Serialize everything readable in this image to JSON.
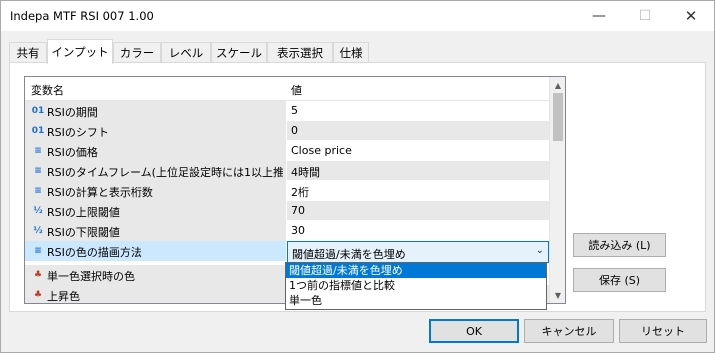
{
  "window": {
    "title": "Indepa MTF RSI 007 1.00"
  },
  "titlebar": {
    "minimize": "—",
    "maximize": "☐",
    "close": "✕"
  },
  "tabs": [
    {
      "label": "共有"
    },
    {
      "label": "インプット"
    },
    {
      "label": "カラー"
    },
    {
      "label": "レベル"
    },
    {
      "label": "スケール"
    },
    {
      "label": "表示選択"
    },
    {
      "label": "仕様"
    }
  ],
  "grid": {
    "col_name": "変数名",
    "col_value": "値",
    "rows": [
      {
        "icon": "01",
        "icon_name": "integer-icon",
        "name": "RSIの期間",
        "value": "5"
      },
      {
        "icon": "01",
        "icon_name": "integer-icon",
        "name": "RSIのシフト",
        "value": "0"
      },
      {
        "icon": "≡",
        "icon_name": "enum-icon",
        "name": "RSIの価格",
        "value": "Close price"
      },
      {
        "icon": "≡",
        "icon_name": "enum-icon",
        "name": "RSIのタイムフレーム(上位足設定時には1以上推…",
        "value": "4時間"
      },
      {
        "icon": "≡",
        "icon_name": "enum-icon",
        "name": "RSIの計算と表示桁数",
        "value": "2桁"
      },
      {
        "icon": "½",
        "icon_name": "double-icon",
        "name": "RSIの上限閾値",
        "value": "70"
      },
      {
        "icon": "½",
        "icon_name": "double-icon",
        "name": "RSIの下限閾値",
        "value": "30"
      },
      {
        "icon": "≡",
        "icon_name": "enum-icon",
        "name": "RSIの色の描画方法",
        "value": "閾値超過/未満を色埋め"
      },
      {
        "icon": "♣",
        "icon_name": "color-icon",
        "name": "単一色選択時の色",
        "value": ""
      },
      {
        "icon": "♣",
        "icon_name": "color-icon",
        "name": "上昇色",
        "value": ""
      }
    ]
  },
  "dropdown": {
    "selected": "閾値超過/未満を色埋め",
    "options": [
      "閾値超過/未満を色埋め",
      "1つ前の指標値と比較",
      "単一色"
    ]
  },
  "side_buttons": {
    "load": "読み込み (L)",
    "save": "保存 (S)"
  },
  "footer_buttons": {
    "ok": "OK",
    "cancel": "キャンセル",
    "reset": "リセット"
  }
}
